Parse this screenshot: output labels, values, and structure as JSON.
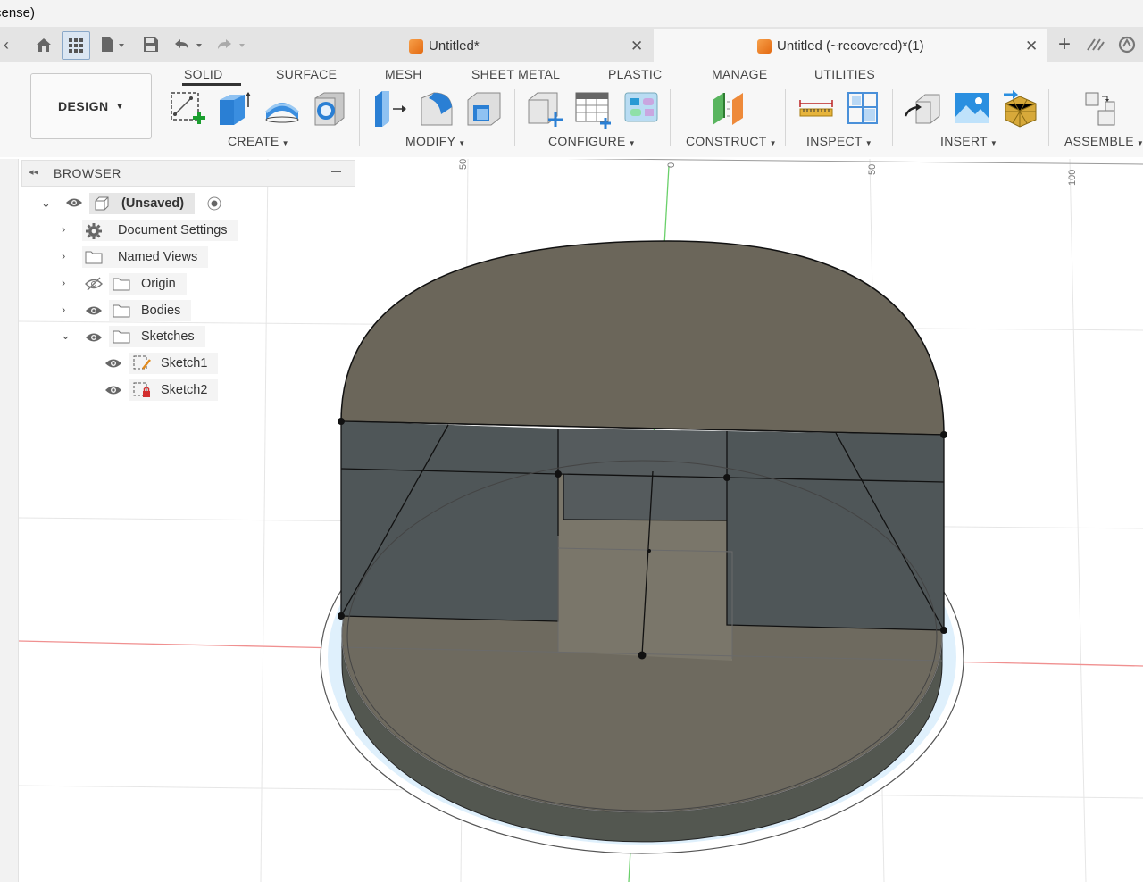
{
  "window": {
    "title_fragment": "cense)"
  },
  "tabs": [
    {
      "label": "Untitled*",
      "active": false
    },
    {
      "label": "Untitled (~recovered)*(1)",
      "active": true
    }
  ],
  "design_menu": {
    "label": "DESIGN"
  },
  "ribbon_tabs": [
    "SOLID",
    "SURFACE",
    "MESH",
    "SHEET METAL",
    "PLASTIC",
    "MANAGE",
    "UTILITIES"
  ],
  "ribbon_groups": {
    "create": "CREATE",
    "modify": "MODIFY",
    "configure": "CONFIGURE",
    "construct": "CONSTRUCT",
    "inspect": "INSPECT",
    "insert": "INSERT",
    "assemble": "ASSEMBLE"
  },
  "browser": {
    "title": "BROWSER",
    "root": "(Unsaved)",
    "items": [
      {
        "label": "Document Settings"
      },
      {
        "label": "Named Views"
      },
      {
        "label": "Origin"
      },
      {
        "label": "Bodies"
      },
      {
        "label": "Sketches"
      }
    ],
    "sketches": [
      {
        "label": "Sketch1"
      },
      {
        "label": "Sketch2"
      }
    ]
  },
  "ruler_labels": [
    "50",
    "0",
    "50",
    "100"
  ],
  "colors": {
    "accent": "#e36a12",
    "body_top": "#6c675b",
    "body_wall": "#4e5456",
    "axis_red": "#f08080",
    "axis_green": "#5fd35f",
    "select_blue": "#2a7fd4"
  }
}
